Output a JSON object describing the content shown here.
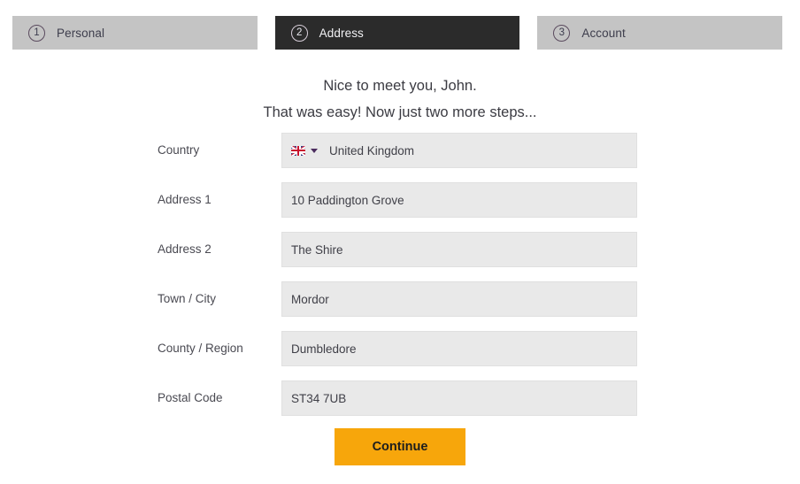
{
  "wizard": {
    "steps": [
      {
        "number": "1",
        "label": "Personal",
        "active": false
      },
      {
        "number": "2",
        "label": "Address",
        "active": true
      },
      {
        "number": "3",
        "label": "Account",
        "active": false
      }
    ]
  },
  "greeting": {
    "line1": "Nice to meet you, John.",
    "line2": "That was easy! Now just two more steps..."
  },
  "form": {
    "country": {
      "label": "Country",
      "value": "United Kingdom",
      "flag_icon": "flag-united-kingdom-icon",
      "caret_icon": "chevron-down-icon"
    },
    "fields": [
      {
        "label": "Address 1",
        "value": "10 Paddington Grove",
        "name": "address-1"
      },
      {
        "label": "Address 2",
        "value": "The Shire",
        "name": "address-2"
      },
      {
        "label": "Town / City",
        "value": "Mordor",
        "name": "town-city"
      },
      {
        "label": "County / Region",
        "value": "Dumbledore",
        "name": "county-region"
      },
      {
        "label": "Postal Code",
        "value": "ST34 7UB",
        "name": "postal-code"
      }
    ]
  },
  "actions": {
    "continue_label": "Continue"
  },
  "colors": {
    "accent": "#f7a60b",
    "active_step_bg": "#2b2b2b",
    "inactive_step_bg": "#c4c4c4",
    "field_bg": "#e9e9e9",
    "text": "#3f3f47"
  }
}
